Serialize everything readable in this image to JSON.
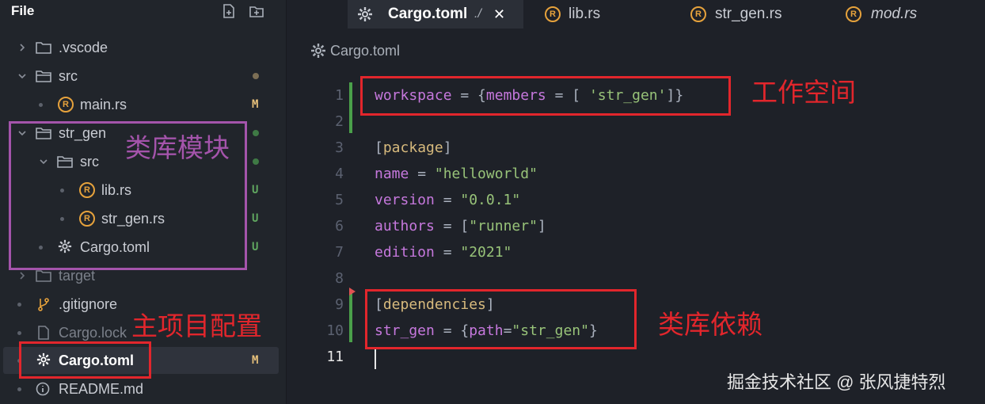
{
  "sidebar": {
    "title": "File",
    "items": [
      {
        "label": ".vscode",
        "status": ""
      },
      {
        "label": "src",
        "status": ""
      },
      {
        "label": "main.rs",
        "status": "M"
      },
      {
        "label": "str_gen",
        "status": ""
      },
      {
        "label": "src",
        "status": ""
      },
      {
        "label": "lib.rs",
        "status": "U"
      },
      {
        "label": "str_gen.rs",
        "status": "U"
      },
      {
        "label": "Cargo.toml",
        "status": "U"
      },
      {
        "label": "target",
        "status": ""
      },
      {
        "label": ".gitignore",
        "status": ""
      },
      {
        "label": "Cargo.lock",
        "status": ""
      },
      {
        "label": "Cargo.toml",
        "status": "M"
      },
      {
        "label": "README.md",
        "status": ""
      }
    ]
  },
  "tabs": [
    {
      "label": "Cargo.toml",
      "suffix": "./",
      "close": "✕"
    },
    {
      "label": "lib.rs"
    },
    {
      "label": "str_gen.rs"
    },
    {
      "label": "mod.rs"
    }
  ],
  "breadcrumb": {
    "label": "Cargo.toml"
  },
  "editor": {
    "line_numbers": [
      "1",
      "2",
      "3",
      "4",
      "5",
      "6",
      "7",
      "8",
      "9",
      "10",
      "11"
    ],
    "code": {
      "l1": {
        "key": "workspace",
        "eq": " = {",
        "key2": "members",
        "eq2": " = [ ",
        "str": "'str_gen'",
        "end": "]}"
      },
      "l3": {
        "open": "[",
        "name": "package",
        "close": "]"
      },
      "l4": {
        "key": "name",
        "eq": " = ",
        "str": "\"helloworld\""
      },
      "l5": {
        "key": "version",
        "eq": " = ",
        "str": "\"0.0.1\""
      },
      "l6": {
        "key": "authors",
        "eq": " = [",
        "str": "\"runner\"",
        "end": "]"
      },
      "l7": {
        "key": "edition",
        "eq": " = ",
        "str": "\"2021\""
      },
      "l9": {
        "open": "[",
        "name": "dependencies",
        "close": "]"
      },
      "l10": {
        "key": "str_gen",
        "eq": " = {",
        "key2": "path",
        "eq2": "=",
        "str": "\"str_gen\"",
        "end": "}"
      }
    }
  },
  "annotations": {
    "workspace": "工作空间",
    "lib_module": "类库模块",
    "main_config": "主项目配置",
    "dependency": "类库依赖"
  },
  "watermark": "掘金技术社区 @ 张风捷特烈",
  "colors": {
    "annotation_red": "#e2262c",
    "annotation_purple": "#a454ab",
    "rust_icon": "#e6a23c",
    "modified": "#e6c07b",
    "untracked": "#5fa55f"
  }
}
